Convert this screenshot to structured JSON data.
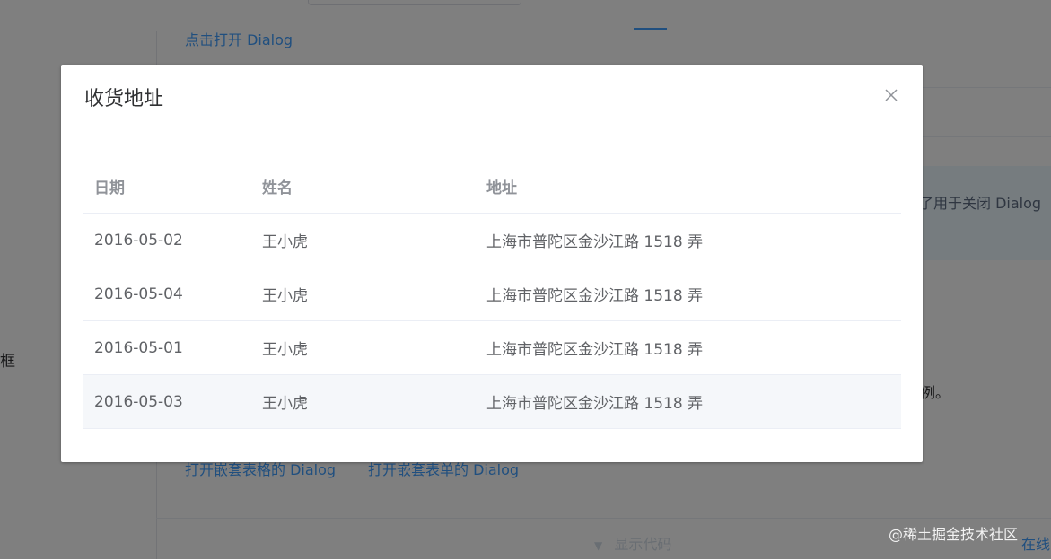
{
  "background": {
    "open_dialog_link": "点击打开 Dialog",
    "sidebar_text": "框",
    "tip_text": "了用于关闭 Dialog",
    "example_text": "例。",
    "nested_table_link": "打开嵌套表格的 Dialog",
    "nested_form_link": "打开嵌套表单的 Dialog",
    "show_code": "显示代码",
    "run_online": "在线"
  },
  "dialog": {
    "title": "收货地址",
    "close_icon": "close-icon",
    "table": {
      "headers": [
        "日期",
        "姓名",
        "地址"
      ],
      "rows": [
        [
          "2016-05-02",
          "王小虎",
          "上海市普陀区金沙江路 1518 弄"
        ],
        [
          "2016-05-04",
          "王小虎",
          "上海市普陀区金沙江路 1518 弄"
        ],
        [
          "2016-05-01",
          "王小虎",
          "上海市普陀区金沙江路 1518 弄"
        ],
        [
          "2016-05-03",
          "王小虎",
          "上海市普陀区金沙江路 1518 弄"
        ]
      ]
    }
  },
  "watermark": "@稀土掘金技术社区",
  "colors": {
    "accent": "#409eff",
    "overlay": "rgba(0,0,0,0.5)",
    "header_text": "#909399",
    "cell_text": "#606266",
    "row_hover": "#f5f7fa"
  }
}
